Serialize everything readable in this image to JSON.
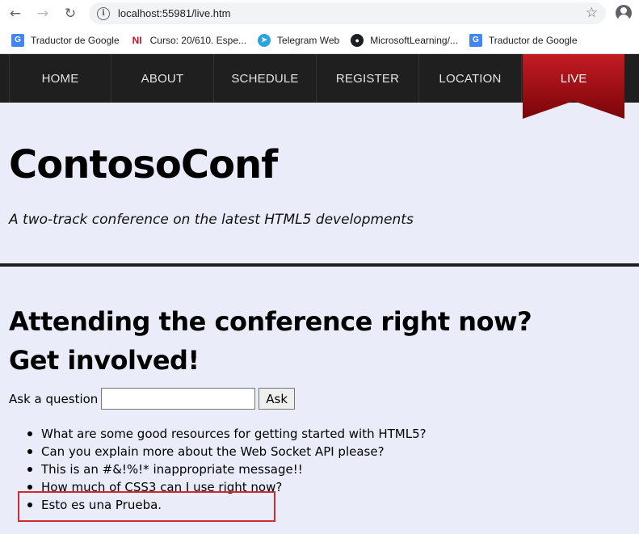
{
  "browser": {
    "url": "localhost:55981/live.htm",
    "bookmarks": [
      {
        "label": "Traductor de Google",
        "icon": "google-translate-icon"
      },
      {
        "label": "Curso: 20/610. Espe...",
        "icon": "ni-icon"
      },
      {
        "label": "Telegram Web",
        "icon": "telegram-icon"
      },
      {
        "label": "MicrosoftLearning/...",
        "icon": "github-icon"
      },
      {
        "label": "Traductor de Google",
        "icon": "google-translate-icon"
      }
    ]
  },
  "nav": {
    "items": [
      "HOME",
      "ABOUT",
      "SCHEDULE",
      "REGISTER",
      "LOCATION",
      "LIVE"
    ],
    "active": "LIVE",
    "ribbon_color": "#9b0f12"
  },
  "header": {
    "title": "ContosoConf",
    "tagline": "A two-track conference on the latest HTML5 developments"
  },
  "main": {
    "heading": "Attending the conference right now? Get involved!",
    "ask_label": "Ask a question",
    "ask_value": "",
    "ask_button": "Ask",
    "questions": [
      "What are some good resources for getting started with HTML5?",
      "Can you explain more about the Web Socket API please?",
      "This is an #&!%!* inappropriate message!!",
      "How much of CSS3 can I use right now?",
      "Esto es una Prueba."
    ],
    "highlight_color": "#cf2a35"
  }
}
